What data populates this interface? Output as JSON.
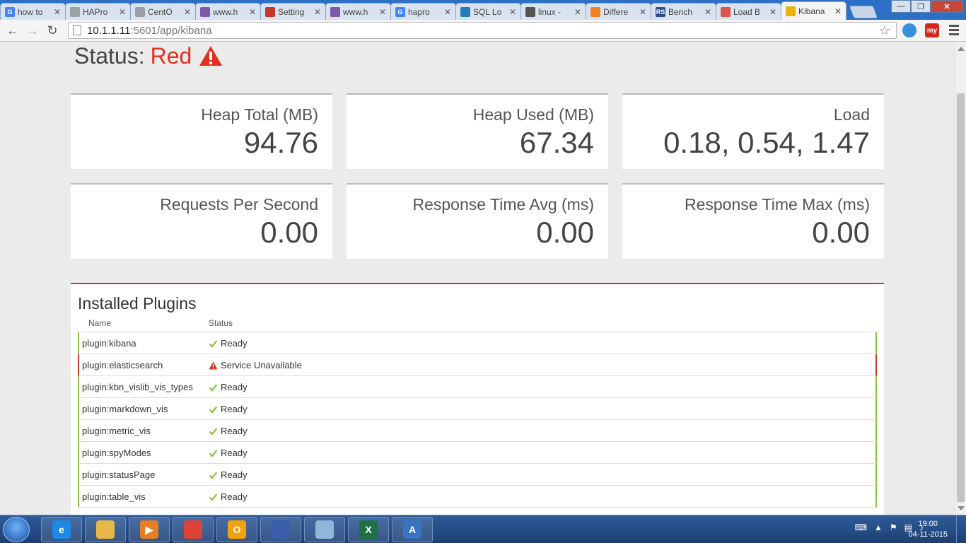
{
  "browser": {
    "tabs": [
      {
        "title": "how to",
        "icon": "google-icon",
        "color": "#4285f4",
        "glyph": "G",
        "active": false
      },
      {
        "title": "HAPro",
        "icon": "document-icon",
        "color": "#9aa0a6",
        "glyph": "",
        "active": false
      },
      {
        "title": "CentO",
        "icon": "document-icon",
        "color": "#9aa0a6",
        "glyph": "",
        "active": false
      },
      {
        "title": "www.h",
        "icon": "haproxy-icon",
        "color": "#7a5aa8",
        "glyph": "",
        "active": false
      },
      {
        "title": "Setting",
        "icon": "settings-icon",
        "color": "#c0392b",
        "glyph": "",
        "active": false
      },
      {
        "title": "www.h",
        "icon": "haproxy-icon",
        "color": "#7a5aa8",
        "glyph": "",
        "active": false
      },
      {
        "title": "hapro",
        "icon": "google-icon",
        "color": "#4285f4",
        "glyph": "G",
        "active": false
      },
      {
        "title": "SQL Lo",
        "icon": "globe-icon",
        "color": "#2a7ab8",
        "glyph": "",
        "active": false
      },
      {
        "title": "linux -",
        "icon": "grid-icon",
        "color": "#555555",
        "glyph": "",
        "active": false
      },
      {
        "title": "Differe",
        "icon": "stackoverflow-icon",
        "color": "#f48024",
        "glyph": "",
        "active": false
      },
      {
        "title": "Bench",
        "icon": "rs-icon",
        "color": "#2d4f8f",
        "glyph": "RS",
        "active": false
      },
      {
        "title": "Load B",
        "icon": "loading-icon",
        "color": "#d9534f",
        "glyph": "",
        "active": false
      },
      {
        "title": "Kibana",
        "icon": "kibana-icon",
        "color": "#e8b30a",
        "glyph": "",
        "active": true
      }
    ],
    "url_host": "10.1.1.11",
    "url_rest": ":5601/app/kibana",
    "ext_my_label": "my"
  },
  "page": {
    "status_label": "Status:",
    "status_value": "Red",
    "metrics": [
      {
        "label": "Heap Total (MB)",
        "value": "94.76"
      },
      {
        "label": "Heap Used (MB)",
        "value": "67.34"
      },
      {
        "label": "Load",
        "value": "0.18, 0.54, 1.47"
      },
      {
        "label": "Requests Per Second",
        "value": "0.00"
      },
      {
        "label": "Response Time Avg (ms)",
        "value": "0.00"
      },
      {
        "label": "Response Time Max (ms)",
        "value": "0.00"
      }
    ],
    "plugins_title": "Installed Plugins",
    "col_name": "Name",
    "col_status": "Status",
    "plugins": [
      {
        "name": "plugin:kibana",
        "status": "Ready",
        "state": "green"
      },
      {
        "name": "plugin:elasticsearch",
        "status": "Service Unavailable",
        "state": "red"
      },
      {
        "name": "plugin:kbn_vislib_vis_types",
        "status": "Ready",
        "state": "green"
      },
      {
        "name": "plugin:markdown_vis",
        "status": "Ready",
        "state": "green"
      },
      {
        "name": "plugin:metric_vis",
        "status": "Ready",
        "state": "green"
      },
      {
        "name": "plugin:spyModes",
        "status": "Ready",
        "state": "green"
      },
      {
        "name": "plugin:statusPage",
        "status": "Ready",
        "state": "green"
      },
      {
        "name": "plugin:table_vis",
        "status": "Ready",
        "state": "green"
      }
    ],
    "colors": {
      "red": "#e0301e",
      "green": "#8cc63f"
    }
  },
  "taskbar": {
    "apps": [
      {
        "name": "ie-icon",
        "color": "#1e88e5",
        "glyph": "e"
      },
      {
        "name": "explorer-icon",
        "color": "#e6b84a",
        "glyph": ""
      },
      {
        "name": "media-player-icon",
        "color": "#e67e22",
        "glyph": "▶"
      },
      {
        "name": "chrome-icon",
        "color": "#db4437",
        "glyph": ""
      },
      {
        "name": "outlook-icon",
        "color": "#f0a30a",
        "glyph": "O"
      },
      {
        "name": "remote-desktop-icon",
        "color": "#3b5fa8",
        "glyph": ""
      },
      {
        "name": "notepad-icon",
        "color": "#8fb7d9",
        "glyph": ""
      },
      {
        "name": "excel-icon",
        "color": "#1d7044",
        "glyph": "X"
      },
      {
        "name": "wordpad-icon",
        "color": "#3a72c4",
        "glyph": "A"
      }
    ],
    "time": "19:00",
    "date": "04-11-2015"
  }
}
